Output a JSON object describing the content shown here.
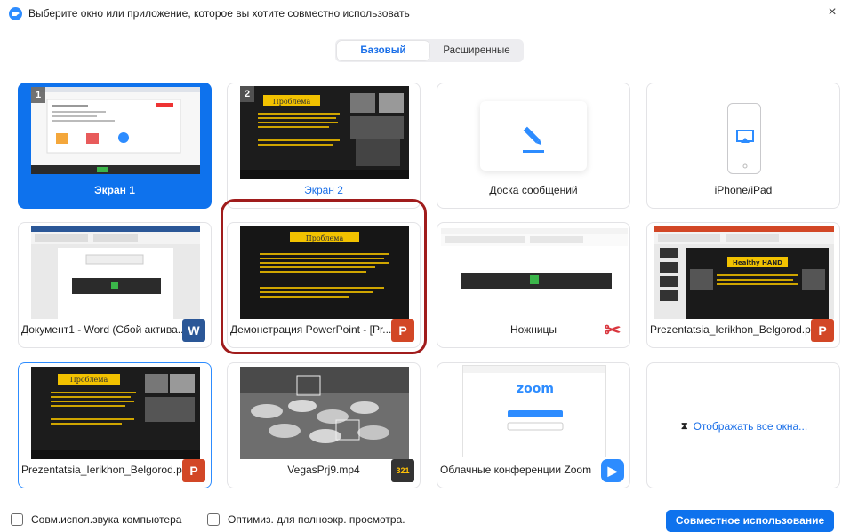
{
  "window": {
    "title": "Выберите окно или приложение, которое вы хотите совместно использовать",
    "close_glyph": "×"
  },
  "tabs": [
    {
      "label": "Базовый",
      "active": true
    },
    {
      "label": "Расширенные",
      "active": false
    }
  ],
  "tiles": [
    {
      "label": "Экран 1",
      "number": "1",
      "selected": true
    },
    {
      "label": "Экран 2",
      "number": "2"
    },
    {
      "label": "Доска сообщений",
      "icon": "pencil-icon"
    },
    {
      "label": "iPhone/iPad",
      "icon": "airplay-icon"
    },
    {
      "label": "Документ1 - Word (Сбой актива...",
      "app_icon": "word-icon",
      "badge": "W"
    },
    {
      "label": "Демонстрация PowerPoint - [Pr...",
      "app_icon": "powerpoint-icon",
      "badge": "P"
    },
    {
      "label": "Ножницы",
      "app_icon": "scissors-icon",
      "badge": "✂"
    },
    {
      "label": "Prezentatsia_Ierikhon_Belgorod.p...",
      "app_icon": "powerpoint-icon",
      "badge": "P"
    },
    {
      "label": "Prezentatsia_Ierikhon_Belgorod.p...",
      "app_icon": "powerpoint-icon",
      "badge": "P"
    },
    {
      "label": "VegasPrj9.mp4",
      "app_icon": "media-player-icon",
      "badge": "321"
    },
    {
      "label": "Облачные конференции Zoom",
      "app_icon": "zoom-icon",
      "badge": "▶"
    }
  ],
  "slide": {
    "heading": "Проблема",
    "brand": "Healthy HAND"
  },
  "zoom_window": {
    "logo": "zoom"
  },
  "show_all": {
    "label": "Отображать все окна...",
    "icon_glyph": "⧗"
  },
  "footer": {
    "share_sound_label": "Совм.испол.звука компьютера",
    "optimize_label": "Оптимиз. для полноэкр. просмотра.",
    "share_button": "Совместное использование"
  },
  "colors": {
    "accent": "#0e72ed",
    "highlight_ring": "#a01c1c",
    "slide_yellow": "#f2c200"
  }
}
